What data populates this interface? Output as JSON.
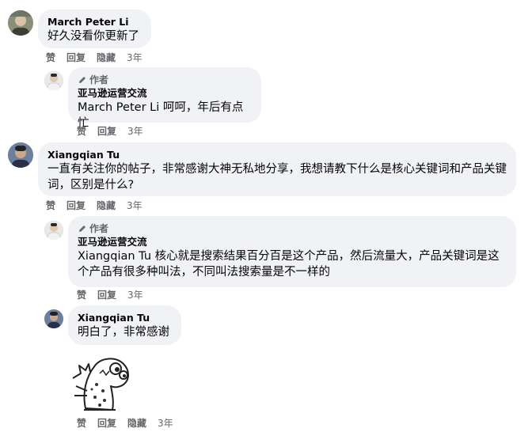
{
  "actions": {
    "like": "赞",
    "reply": "回复",
    "hide": "隐藏"
  },
  "comments": [
    {
      "author": "March Peter Li",
      "text": "好久没看你更新了",
      "time": "3年"
    },
    {
      "author_badge": "作者",
      "author": "亚马逊运营交流",
      "mention": "March Peter Li",
      "text": " 呵呵，年后有点忙",
      "time": "3年"
    },
    {
      "author": "Xiangqian Tu",
      "text": "一直有关注你的帖子，非常感谢大神无私地分享，我想请教下什么是核心关键词和产品关键词，区别是什么?",
      "time": "3年"
    },
    {
      "author_badge": "作者",
      "author": "亚马逊运营交流",
      "mention": "Xiangqian Tu",
      "text": " 核心就是搜索结果百分百是这个产品，然后流量大，产品关键词是这个产品有很多种叫法，不同叫法搜索量是不一样的",
      "time": "3年"
    },
    {
      "author": "Xiangqian Tu",
      "text": "明白了，非常感谢",
      "time": "3年"
    },
    {
      "sticker": "dinosaur-sticker",
      "time": "3年"
    }
  ]
}
